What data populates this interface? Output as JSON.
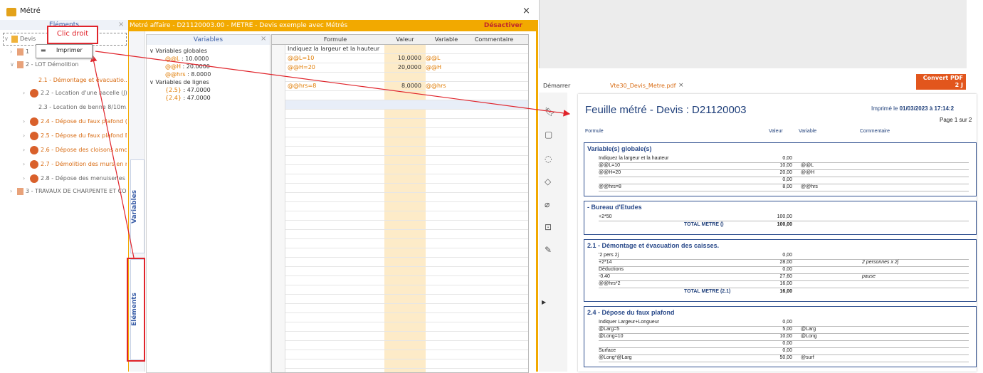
{
  "window": {
    "title": "Métré",
    "close_symbol": "×"
  },
  "tree": {
    "header": "Eléments",
    "close": "×",
    "items": [
      {
        "label": "Devis",
        "style": "gray"
      },
      {
        "label": "1",
        "style": "gray"
      },
      {
        "label": "2 - LOT Démolition",
        "style": "gray"
      },
      {
        "label": "2.1 - Démontage et évacuatio...",
        "style": "orange"
      },
      {
        "label": "2.2 - Location d'une nacelle  (J)",
        "style": "gray"
      },
      {
        "label": "2.3 - Location de benne 8/10m...",
        "style": "gray"
      },
      {
        "label": "2.4 - Dépose du faux plafond  (...",
        "style": "orange"
      },
      {
        "label": "2.5 - Dépose du faux plafond B...",
        "style": "orange"
      },
      {
        "label": "2.6 - Dépose des cloisons amov...",
        "style": "orange"
      },
      {
        "label": "2.7 - Démolition des murs en m...",
        "style": "orange"
      },
      {
        "label": "2.8 - Dépose des menuiseries i...",
        "style": "gray"
      },
      {
        "label": "3 - TRAVAUX DE CHARPENTE ET CO...",
        "style": "gray"
      }
    ]
  },
  "context_menu": {
    "item": "Imprimer"
  },
  "annotation": {
    "callout": "Clic droit"
  },
  "metre": {
    "title": "Metré affaire - D21120003.00 - METRE - Devis exemple avec Métrés",
    "deactivate": "Désactiver",
    "tabs": {
      "variables": "Variables",
      "elements": "Eléments"
    }
  },
  "variables": {
    "header": "Variables",
    "close": "×",
    "groups": [
      {
        "label": "Variables globales",
        "items": [
          {
            "name": "@@L",
            "value": " : 10.0000"
          },
          {
            "name": "@@H",
            "value": " : 20.0000"
          },
          {
            "name": "@@hrs",
            "value": " : 8.0000"
          }
        ]
      },
      {
        "label": "Variables de lignes",
        "items": [
          {
            "name": "{2.5}",
            "value": " : 47.0000"
          },
          {
            "name": "{2.4}",
            "value": " : 47.0000"
          }
        ]
      }
    ]
  },
  "grid": {
    "columns": [
      "Formule",
      "Valeur",
      "Variable",
      "Commentaire"
    ],
    "rows": [
      {
        "formule": "Indiquez la largeur et la hauteur",
        "valeur": "",
        "variable": ""
      },
      {
        "formule": "@@L=10",
        "valeur": "10,0000",
        "variable": "@@L"
      },
      {
        "formule": "@@H=20",
        "valeur": "20,0000",
        "variable": "@@H"
      },
      {
        "formule": "",
        "valeur": "",
        "variable": ""
      },
      {
        "formule": "@@hrs=8",
        "valeur": "8,0000",
        "variable": "@@hrs"
      }
    ]
  },
  "viewer": {
    "home_tab": "Démarrer",
    "file_tab": "Vte30_Devis_Metre.pdf",
    "convert_button": "Convert PDF 2 J"
  },
  "pdf": {
    "title": "Feuille métré - Devis : D21120003",
    "printed_prefix": "Imprimé le ",
    "printed_date": "01/03/2023 à 17:14:2",
    "page": "Page 1 sur 2",
    "columns": [
      "Formule",
      "Valeur",
      "Variable",
      "Commentaire"
    ],
    "sections": [
      {
        "title": "Variable(s) globale(s)",
        "rows": [
          {
            "f": "Indiquez la largeur et la hauteur",
            "v": "0,00",
            "var": "",
            "c": ""
          },
          {
            "f": "@@L=10",
            "v": "10,00",
            "var": "@@L",
            "c": ""
          },
          {
            "f": "@@H=20",
            "v": "20,00",
            "var": "@@H",
            "c": ""
          },
          {
            "f": "",
            "v": "0,00",
            "var": "",
            "c": ""
          },
          {
            "f": "@@hrs=8",
            "v": "8,00",
            "var": "@@hrs",
            "c": ""
          }
        ],
        "total_label": "",
        "total_value": ""
      },
      {
        "title": "- Bureau d'Etudes",
        "rows": [
          {
            "f": "+2*50",
            "v": "100,00",
            "var": "",
            "c": ""
          }
        ],
        "total_label": "TOTAL METRE ()",
        "total_value": "100,00"
      },
      {
        "title": "2.1 - Démontage et évacuation des caisses.",
        "rows": [
          {
            "f": "'2 pers 2j",
            "v": "0,00",
            "var": "",
            "c": ""
          },
          {
            "f": "+2*14",
            "v": "28,00",
            "var": "",
            "c": "2 personnes x 2j"
          },
          {
            "f": "Déductions",
            "v": "0,00",
            "var": "",
            "c": ""
          },
          {
            "f": "-0.40",
            "v": "27,60",
            "var": "",
            "c": "pause"
          },
          {
            "f": "@@hrs*2",
            "v": "16,00",
            "var": "",
            "c": ""
          }
        ],
        "total_label": "TOTAL METRE (2.1)",
        "total_value": "16,00"
      },
      {
        "title": "2.4 - Dépose du faux plafond",
        "rows": [
          {
            "f": "Indiquer Largeur+Longueur",
            "v": "0,00",
            "var": "",
            "c": ""
          },
          {
            "f": "@Larg=5",
            "v": "5,00",
            "var": "@Larg",
            "c": ""
          },
          {
            "f": "@Long=10",
            "v": "10,00",
            "var": "@Long",
            "c": ""
          },
          {
            "f": "",
            "v": "0,00",
            "var": "",
            "c": ""
          },
          {
            "f": "Surface",
            "v": "0,00",
            "var": "",
            "c": ""
          },
          {
            "f": "@Long*@Larg",
            "v": "50,00",
            "var": "@surf",
            "c": ""
          }
        ],
        "total_label": "",
        "total_value": ""
      }
    ]
  },
  "colors": {
    "accent": "#f2a900",
    "annotation": "#e0242b",
    "pdf_title": "#1f3f7a"
  }
}
